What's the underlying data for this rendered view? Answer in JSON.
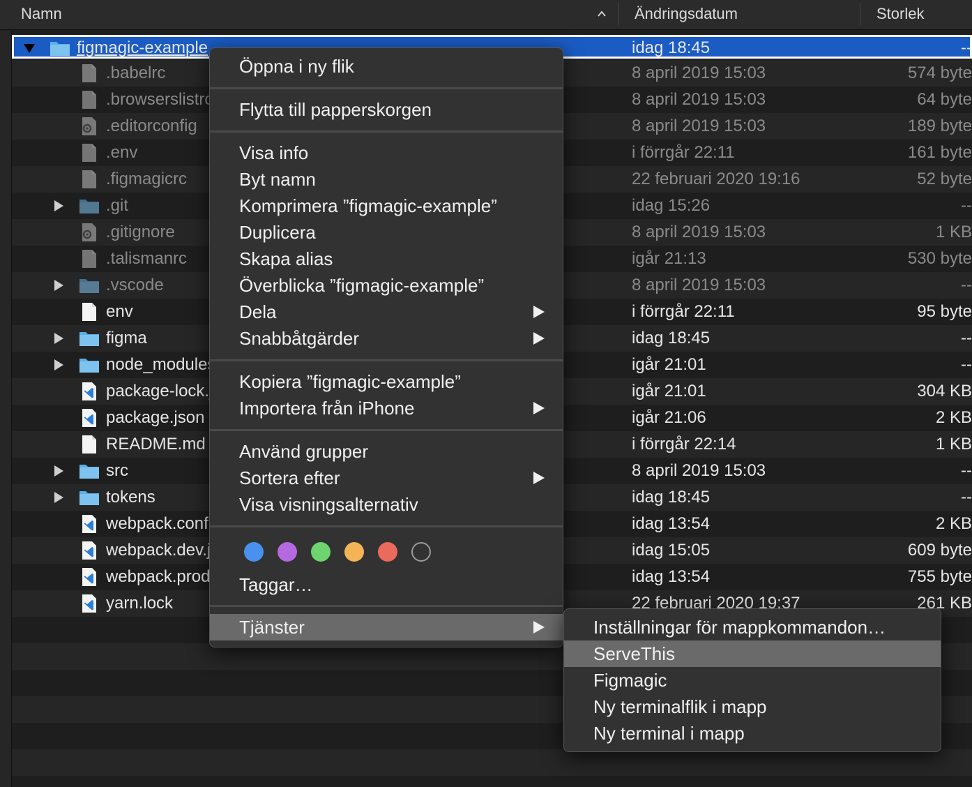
{
  "header": {
    "name_col": "Namn",
    "date_col": "Ändringsdatum",
    "size_col": "Storlek"
  },
  "files": [
    {
      "name": "figmagic-example",
      "date": "idag 18:45",
      "size": "--",
      "type": "folder",
      "expanded": true,
      "selected": true,
      "dim": false
    },
    {
      "name": ".babelrc",
      "date": "8 april 2019 15:03",
      "size": "574 byte",
      "type": "file",
      "dim": true
    },
    {
      "name": ".browserslistrc",
      "date": "8 april 2019 15:03",
      "size": "64 byte",
      "type": "file",
      "dim": true
    },
    {
      "name": ".editorconfig",
      "date": "8 april 2019 15:03",
      "size": "189 byte",
      "type": "config",
      "dim": true
    },
    {
      "name": ".env",
      "date": "i förrgår 22:11",
      "size": "161 byte",
      "type": "file",
      "dim": true
    },
    {
      "name": ".figmagicrc",
      "date": "22 februari 2020 19:16",
      "size": "52 byte",
      "type": "file",
      "dim": true
    },
    {
      "name": ".git",
      "date": "idag 15:26",
      "size": "--",
      "type": "folder",
      "dim": true
    },
    {
      "name": ".gitignore",
      "date": "8 april 2019 15:03",
      "size": "1 KB",
      "type": "config",
      "dim": true
    },
    {
      "name": ".talismanrc",
      "date": "igår 21:13",
      "size": "530 byte",
      "type": "file",
      "dim": true
    },
    {
      "name": ".vscode",
      "date": "8 april 2019 15:03",
      "size": "--",
      "type": "folder",
      "dim": true
    },
    {
      "name": "env",
      "date": "i förrgår 22:11",
      "size": "95 byte",
      "type": "file",
      "dim": false
    },
    {
      "name": "figma",
      "date": "idag 18:45",
      "size": "--",
      "type": "folder",
      "dim": false
    },
    {
      "name": "node_modules",
      "date": "igår 21:01",
      "size": "--",
      "type": "folder",
      "dim": false
    },
    {
      "name": "package-lock.json",
      "date": "igår 21:01",
      "size": "304 KB",
      "type": "vscode",
      "dim": false
    },
    {
      "name": "package.json",
      "date": "igår 21:06",
      "size": "2 KB",
      "type": "vscode",
      "dim": false
    },
    {
      "name": "README.md",
      "date": "i förrgår 22:14",
      "size": "1 KB",
      "type": "file",
      "dim": false
    },
    {
      "name": "src",
      "date": "8 april 2019 15:03",
      "size": "--",
      "type": "folder",
      "dim": false
    },
    {
      "name": "tokens",
      "date": "idag 18:45",
      "size": "--",
      "type": "folder",
      "dim": false
    },
    {
      "name": "webpack.config.js",
      "date": "idag 13:54",
      "size": "2 KB",
      "type": "vscode",
      "dim": false
    },
    {
      "name": "webpack.dev.js",
      "date": "idag 15:05",
      "size": "609 byte",
      "type": "vscode",
      "dim": false
    },
    {
      "name": "webpack.prod.js",
      "date": "idag 13:54",
      "size": "755 byte",
      "type": "vscode",
      "dim": false
    },
    {
      "name": "yarn.lock",
      "date": "22 februari 2020 19:37",
      "size": "261 KB",
      "type": "vscode",
      "dim": false
    }
  ],
  "context_menu": {
    "open_new_tab": "Öppna i ny flik",
    "move_to_trash": "Flytta till papperskorgen",
    "get_info": "Visa info",
    "rename": "Byt namn",
    "compress": "Komprimera ”figmagic-example”",
    "duplicate": "Duplicera",
    "make_alias": "Skapa alias",
    "quick_look": "Överblicka ”figmagic-example”",
    "share": "Dela",
    "quick_actions": "Snabbåtgärder",
    "copy": "Kopiera ”figmagic-example”",
    "import_iphone": "Importera från iPhone",
    "use_groups": "Använd grupper",
    "sort_by": "Sortera efter",
    "view_options": "Visa visningsalternativ",
    "tags": "Taggar…",
    "services": "Tjänster"
  },
  "tag_colors": [
    "#4a90f0",
    "#b569e0",
    "#6ed46e",
    "#f3b458",
    "#ea6a5c",
    "none"
  ],
  "services_menu": {
    "folder_actions": "Inställningar för mappkommandon…",
    "serve_this": "ServeThis",
    "figmagic": "Figmagic",
    "new_terminal_tab": "Ny terminalflik i mapp",
    "new_terminal": "Ny terminal i mapp"
  },
  "colors": {
    "selection": "#1a5bc4",
    "folder": "#5ab0e8",
    "menu_bg": "#323232",
    "highlight": "#6a6a6a"
  }
}
